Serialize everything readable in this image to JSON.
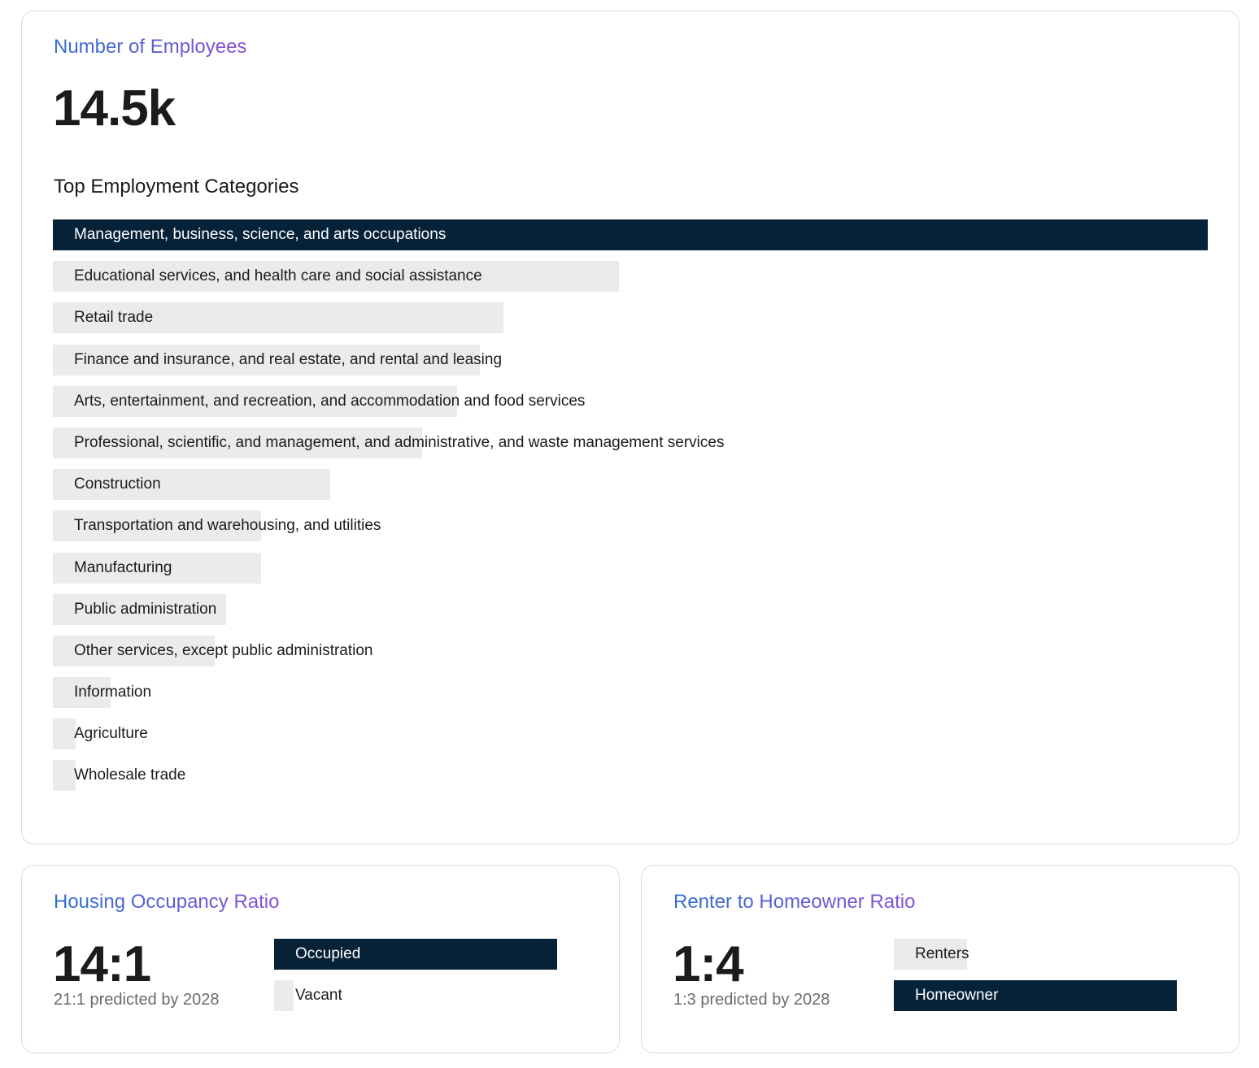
{
  "employees": {
    "title": "Number of Employees",
    "value": "14.5k",
    "categories_heading": "Top Employment Categories",
    "categories": [
      {
        "label": "Management, business, science, and arts occupations",
        "share": 1.0
      },
      {
        "label": "Educational services, and health care and social assistance",
        "share": 0.49
      },
      {
        "label": "Retail trade",
        "share": 0.39
      },
      {
        "label": "Finance and insurance, and real estate, and rental and leasing",
        "share": 0.37
      },
      {
        "label": "Arts, entertainment, and recreation, and accommodation and food services",
        "share": 0.35
      },
      {
        "label": "Professional, scientific, and management, and administrative, and waste management services",
        "share": 0.32
      },
      {
        "label": "Construction",
        "share": 0.24
      },
      {
        "label": "Transportation and warehousing, and utilities",
        "share": 0.18
      },
      {
        "label": "Manufacturing",
        "share": 0.18
      },
      {
        "label": "Public administration",
        "share": 0.15
      },
      {
        "label": "Other services, except public administration",
        "share": 0.14
      },
      {
        "label": "Information",
        "share": 0.05
      },
      {
        "label": "Agriculture",
        "share": 0.02
      },
      {
        "label": "Wholesale trade",
        "share": 0.02
      }
    ]
  },
  "housing": {
    "title": "Housing Occupancy Ratio",
    "ratio": "14:1",
    "prediction": "21:1 predicted by 2028",
    "bars": [
      {
        "label": "Occupied",
        "share": 1.0
      },
      {
        "label": "Vacant",
        "share": 0.07
      }
    ]
  },
  "renter": {
    "title": "Renter to Homeowner Ratio",
    "ratio": "1:4",
    "prediction": "1:3 predicted by 2028",
    "bars": [
      {
        "label": "Renters",
        "share": 0.26
      },
      {
        "label": "Homeowner",
        "share": 1.0
      }
    ]
  },
  "colors": {
    "bar_dark": "#062238",
    "bar_light": "#ebebeb",
    "title_gradient_start": "#2f6fd0",
    "title_gradient_end": "#8a4fd6"
  }
}
